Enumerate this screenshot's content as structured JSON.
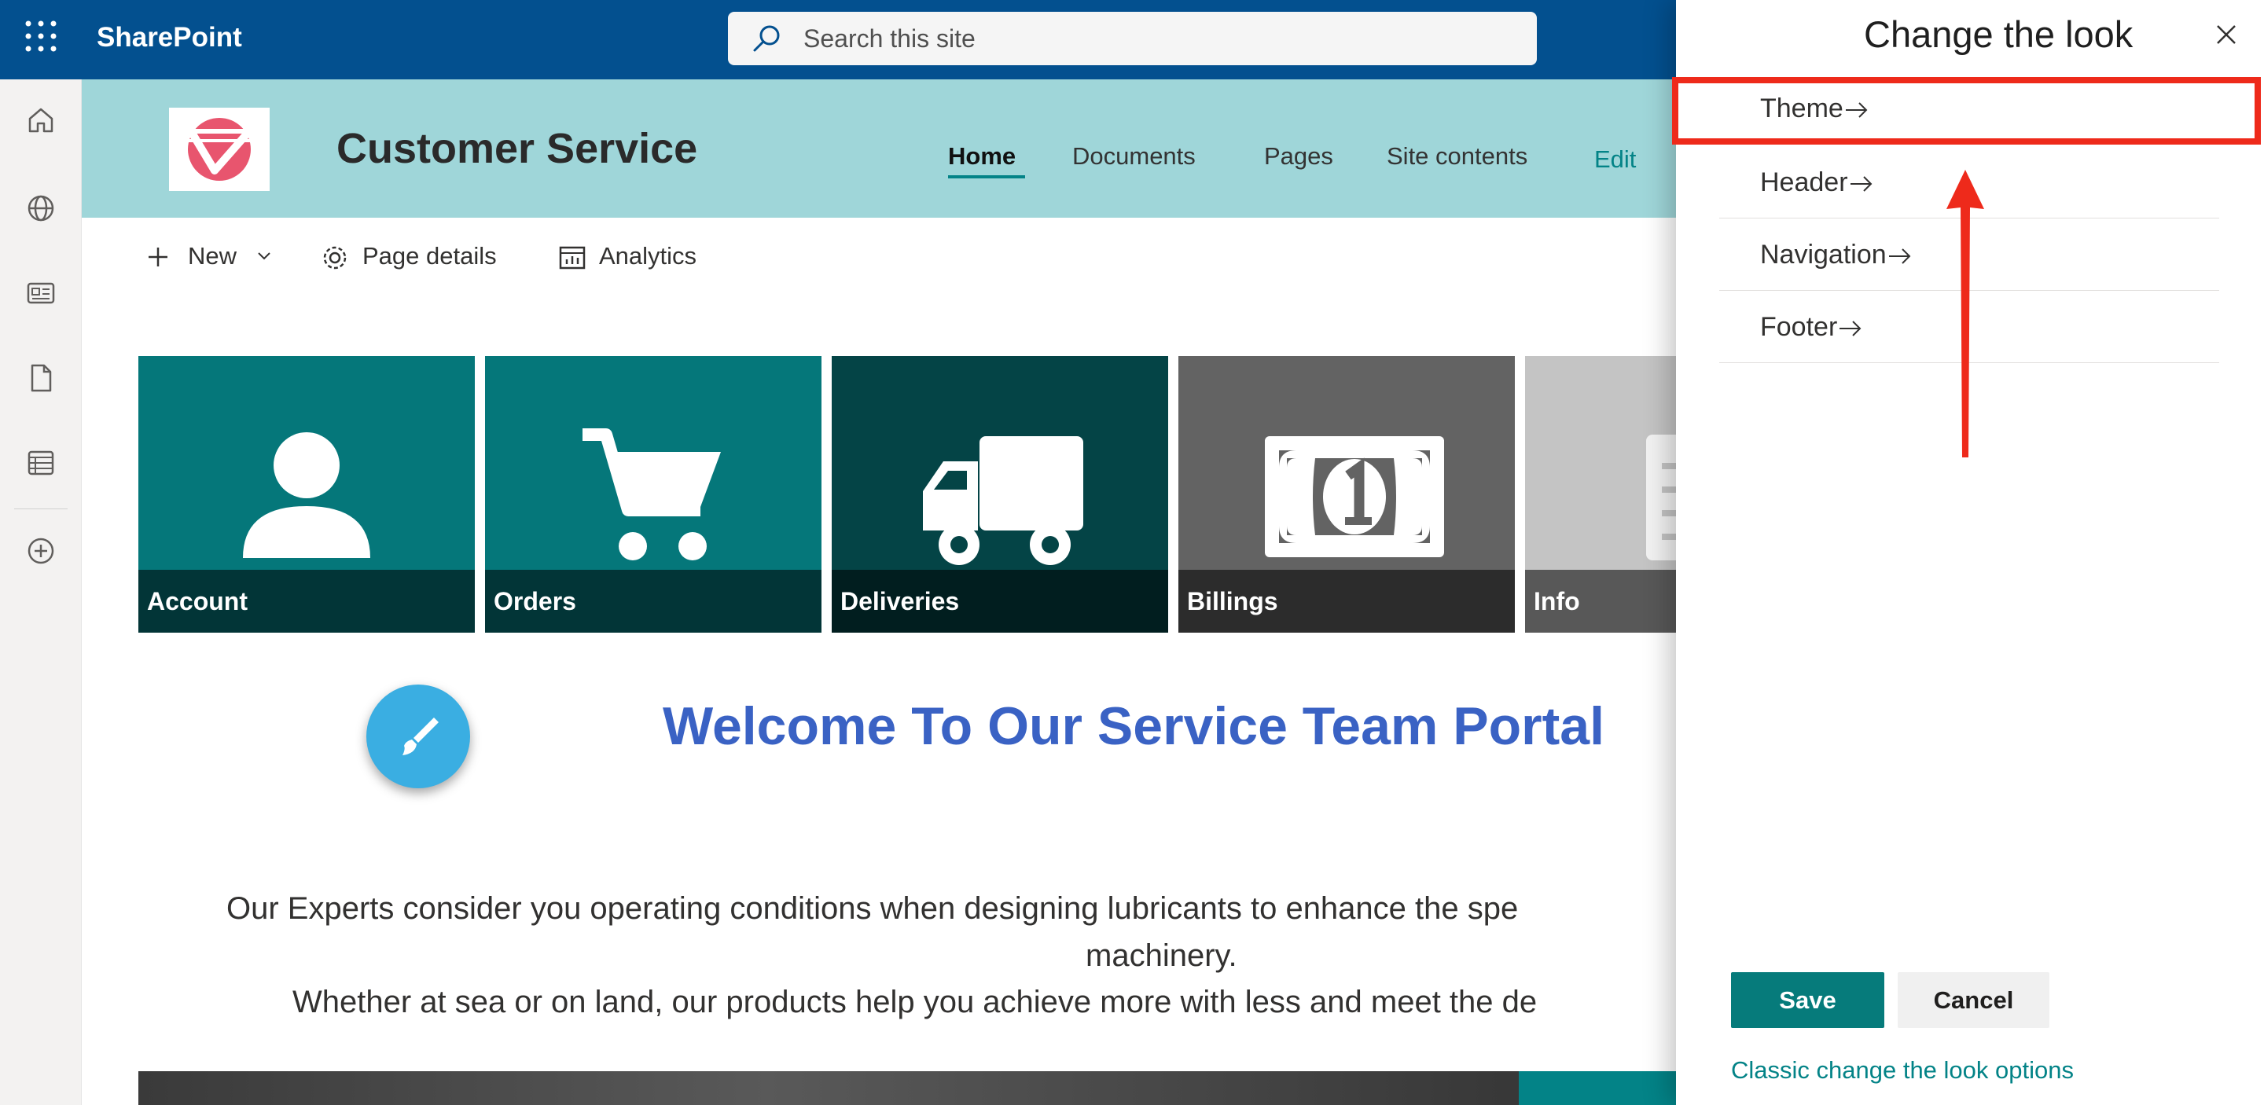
{
  "suitebar": {
    "app_name": "SharePoint",
    "search_placeholder": "Search this site",
    "waffle_icon": "app-launcher-icon",
    "search_icon": "search-icon"
  },
  "rail": {
    "items": [
      {
        "icon": "home-icon"
      },
      {
        "icon": "globe-icon"
      },
      {
        "icon": "news-icon"
      },
      {
        "icon": "document-icon"
      },
      {
        "icon": "list-icon"
      },
      {
        "icon": "add-circle-icon"
      }
    ]
  },
  "site": {
    "title": "Customer Service",
    "nav": {
      "home": "Home",
      "documents": "Documents",
      "pages": "Pages",
      "site_contents": "Site contents",
      "edit": "Edit"
    }
  },
  "commandbar": {
    "new": "New",
    "page_details": "Page details",
    "analytics": "Analytics"
  },
  "tiles": [
    {
      "label": "Account",
      "color": "#05777a",
      "icon": "person-icon"
    },
    {
      "label": "Orders",
      "color": "#05777a",
      "icon": "cart-icon"
    },
    {
      "label": "Deliveries",
      "color": "#044446",
      "icon": "truck-icon"
    },
    {
      "label": "Billings",
      "color": "#636363",
      "icon": "money-icon"
    },
    {
      "label": "Info",
      "color": "#c4c4c4",
      "icon": "document-icon"
    }
  ],
  "content": {
    "welcome": "Welcome To Our Service Team Portal",
    "para_line1": "Our Experts consider you operating conditions when designing lubricants to enhance the spe",
    "para_line2": "machinery.",
    "para_line3": "Whether at sea or on land, our products help you achieve more with less and meet the de"
  },
  "panel": {
    "title": "Change the look",
    "items": [
      {
        "label": "Theme"
      },
      {
        "label": "Header"
      },
      {
        "label": "Navigation"
      },
      {
        "label": "Footer"
      }
    ],
    "save": "Save",
    "cancel": "Cancel",
    "classic_link": "Classic change the look options"
  },
  "colors": {
    "suitebar": "#03508f",
    "site_header": "#9fd6d9",
    "accent": "#038387",
    "welcome": "#3a62c4",
    "highlight": "#ee2a1b"
  }
}
